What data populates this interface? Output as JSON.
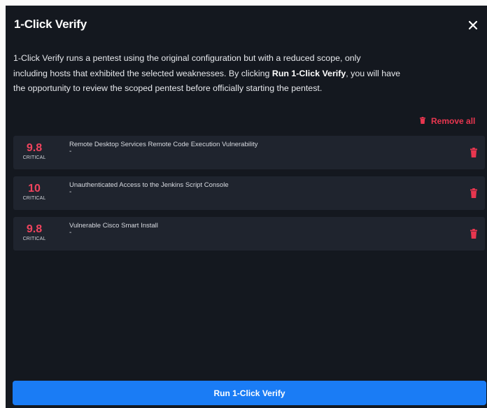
{
  "modal": {
    "title": "1-Click Verify",
    "close_icon": "close-icon",
    "description": {
      "part1": "1-Click Verify runs a pentest using the original configuration but with a reduced scope, only",
      "part2": "including hosts that exhibited the selected weaknesses. By clicking ",
      "bold": "Run 1-Click Verify",
      "part3": ", you will have",
      "part4": "the opportunity to review the scoped pentest before officially starting the pentest."
    },
    "remove_all_label": "Remove all",
    "accent_color": "#e8364f",
    "weaknesses": [
      {
        "score": "9.8",
        "severity": "CRITICAL",
        "name": "Remote Desktop Services Remote Code Execution Vulnerability",
        "detail": "-"
      },
      {
        "score": "10",
        "severity": "CRITICAL",
        "name": "Unauthenticated Access to the Jenkins Script Console",
        "detail": "-"
      },
      {
        "score": "9.8",
        "severity": "CRITICAL",
        "name": "Vulnerable Cisco Smart Install",
        "detail": "-"
      }
    ],
    "run_button_label": "Run 1-Click Verify",
    "button_color": "#1a7cf5"
  }
}
